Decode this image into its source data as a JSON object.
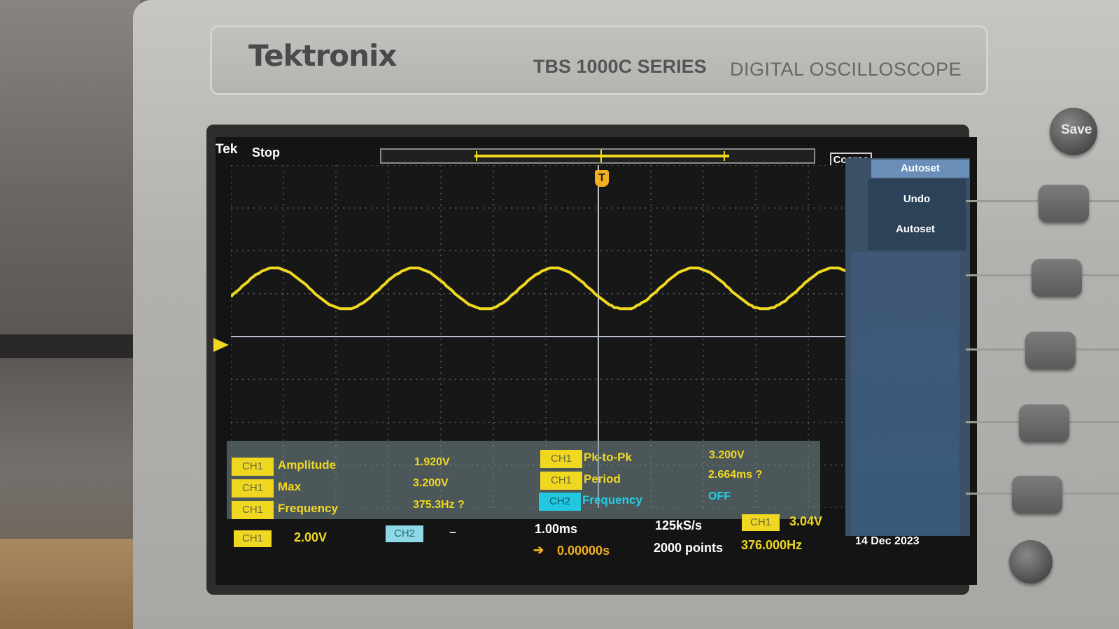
{
  "device": {
    "brand": "Tektronix",
    "series": "TBS 1000C SERIES",
    "subtitle": "DIGITAL OSCILLOSCOPE",
    "save_label": "Save"
  },
  "status": {
    "logo": "Tek",
    "run_state": "Stop",
    "knob_mode": "Coarse",
    "trigger_marker": "T"
  },
  "waveform": {
    "channel": "CH1",
    "color": "#f0d820",
    "frequency_hz": 375.3,
    "vertical_scale_v": 2.0,
    "min_v": 1.28,
    "max_v": 3.2,
    "time_per_div_ms": 1.0
  },
  "measurements": {
    "left": [
      {
        "channel": "CH1",
        "label": "Amplitude",
        "value": "1.920V"
      },
      {
        "channel": "CH1",
        "label": "Max",
        "value": "3.200V"
      },
      {
        "channel": "CH1",
        "label": "Frequency",
        "value": "375.3Hz ?"
      }
    ],
    "right": [
      {
        "channel": "CH1",
        "label": "Pk-to-Pk",
        "value": "3.200V"
      },
      {
        "channel": "CH1",
        "label": "Period",
        "value": "2.664ms ?"
      },
      {
        "channel": "CH2",
        "label": "Frequency",
        "value": "OFF"
      }
    ]
  },
  "bottom": {
    "ch1_tag": "CH1",
    "ch1_scale": "2.00V",
    "ch2_tag": "CH2",
    "ch2_scale": "–",
    "timebase": "1.00ms",
    "position": "0.00000s",
    "sample_rate": "125kS/s",
    "record_length": "2000 points",
    "trigger_ch": "CH1",
    "trigger_level": "3.04V",
    "trigger_freq": "376.000Hz",
    "date": "14 Dec 2023"
  },
  "menu": {
    "title": "Autoset",
    "items": [
      "Undo",
      "Autoset"
    ]
  }
}
